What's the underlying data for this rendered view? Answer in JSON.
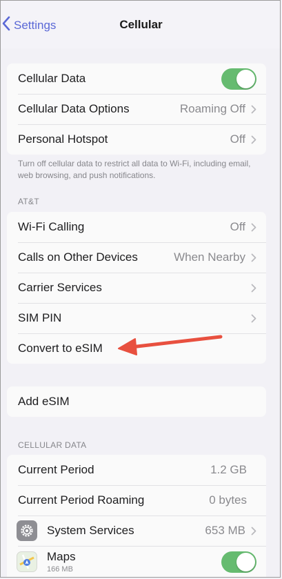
{
  "nav": {
    "back_label": "Settings",
    "title": "Cellular"
  },
  "group1": {
    "cellular_data": {
      "label": "Cellular Data",
      "toggle_on": true
    },
    "cellular_data_options": {
      "label": "Cellular Data Options",
      "value": "Roaming Off"
    },
    "personal_hotspot": {
      "label": "Personal Hotspot",
      "value": "Off"
    }
  },
  "footnote": "Turn off cellular data to restrict all data to Wi-Fi, including email, web browsing, and push notifications.",
  "carrier_header": "AT&T",
  "group2": {
    "wifi_calling": {
      "label": "Wi-Fi Calling",
      "value": "Off"
    },
    "calls_other_devices": {
      "label": "Calls on Other Devices",
      "value": "When Nearby"
    },
    "carrier_services": {
      "label": "Carrier Services"
    },
    "sim_pin": {
      "label": "SIM PIN"
    },
    "convert_esim": {
      "label": "Convert to eSIM"
    }
  },
  "add_esim": {
    "label": "Add eSIM"
  },
  "cellular_data_header": "CELLULAR DATA",
  "group3": {
    "current_period": {
      "label": "Current Period",
      "value": "1.2 GB"
    },
    "current_period_roaming": {
      "label": "Current Period Roaming",
      "value": "0 bytes"
    },
    "system_services": {
      "label": "System Services",
      "value": "653 MB",
      "icon": "gear-icon"
    },
    "maps": {
      "label": "Maps",
      "subtitle": "166 MB",
      "icon": "maps-icon",
      "toggle_on": true
    }
  },
  "colors": {
    "accent": "#5a68d6",
    "toggle_green": "#66bb70",
    "annotation_arrow": "#e8503f"
  }
}
